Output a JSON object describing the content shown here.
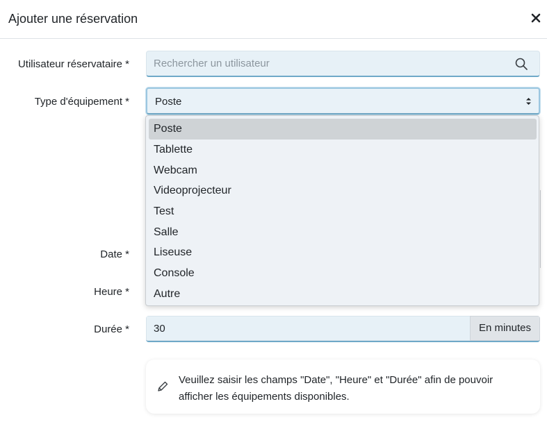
{
  "modal": {
    "title": "Ajouter une réservation",
    "close_icon": "close-icon"
  },
  "form": {
    "user": {
      "label": "Utilisateur réservataire *",
      "placeholder": "Rechercher un utilisateur",
      "icon": "search-icon"
    },
    "equipment_type": {
      "label": "Type d'équipement *",
      "value": "Poste",
      "options": [
        "Poste",
        "Tablette",
        "Webcam",
        "Videoprojecteur",
        "Test",
        "Salle",
        "Liseuse",
        "Console",
        "Autre"
      ],
      "selected_index": 0
    },
    "date": {
      "label": "Date *"
    },
    "heure": {
      "label": "Heure *"
    },
    "duree": {
      "label": "Durée *",
      "value": "30",
      "addon": "En minutes"
    }
  },
  "info": {
    "icon": "pencil-icon",
    "text": "Veuillez saisir les champs \"Date\", \"Heure\" et \"Durée\" afin de pouvoir afficher les équipements disponibles."
  },
  "colors": {
    "field_bg": "#e7f1f7",
    "field_focus_border": "#6fa9c8",
    "dropdown_bg": "#eef2f6",
    "selected_option_bg": "#cfd3d6"
  }
}
